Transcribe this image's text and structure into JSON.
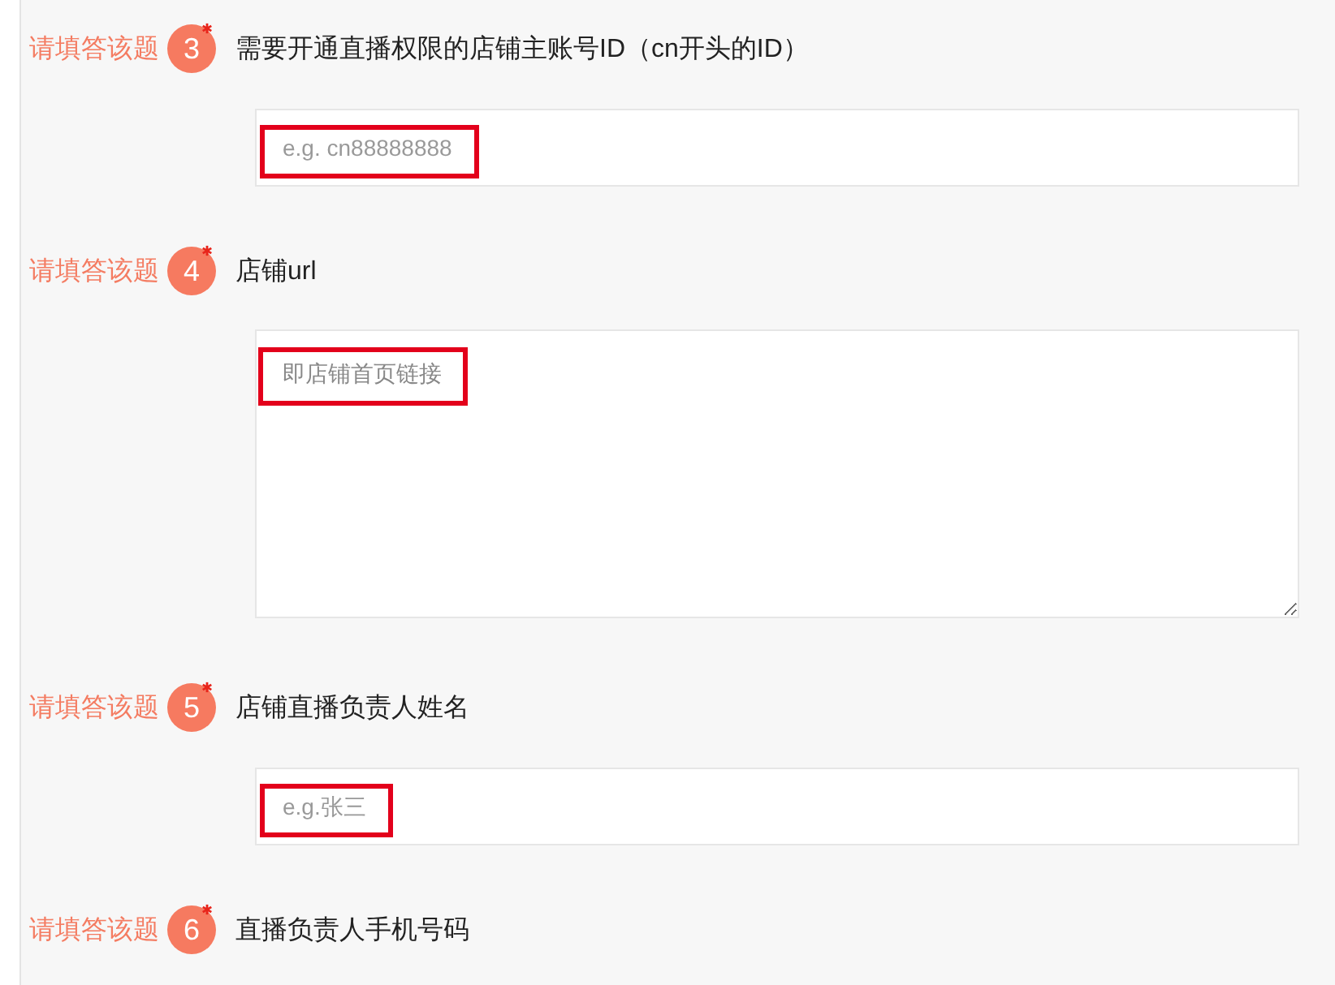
{
  "questions": [
    {
      "warning": "请填答该题",
      "number": "3",
      "required": true,
      "title": "需要开通直播权限的店铺主账号ID（cn开头的ID）",
      "field": {
        "kind": "input",
        "placeholder": "e.g. cn88888888",
        "highlighted": true
      }
    },
    {
      "warning": "请填答该题",
      "number": "4",
      "required": true,
      "title": "店铺url",
      "field": {
        "kind": "textarea",
        "placeholder": "即店铺首页链接",
        "highlighted": true
      }
    },
    {
      "warning": "请填答该题",
      "number": "5",
      "required": true,
      "title": "店铺直播负责人姓名",
      "field": {
        "kind": "input",
        "placeholder": "e.g.张三",
        "highlighted": true
      }
    },
    {
      "warning": "请填答该题",
      "number": "6",
      "required": true,
      "title": "直播负责人手机号码"
    }
  ]
}
